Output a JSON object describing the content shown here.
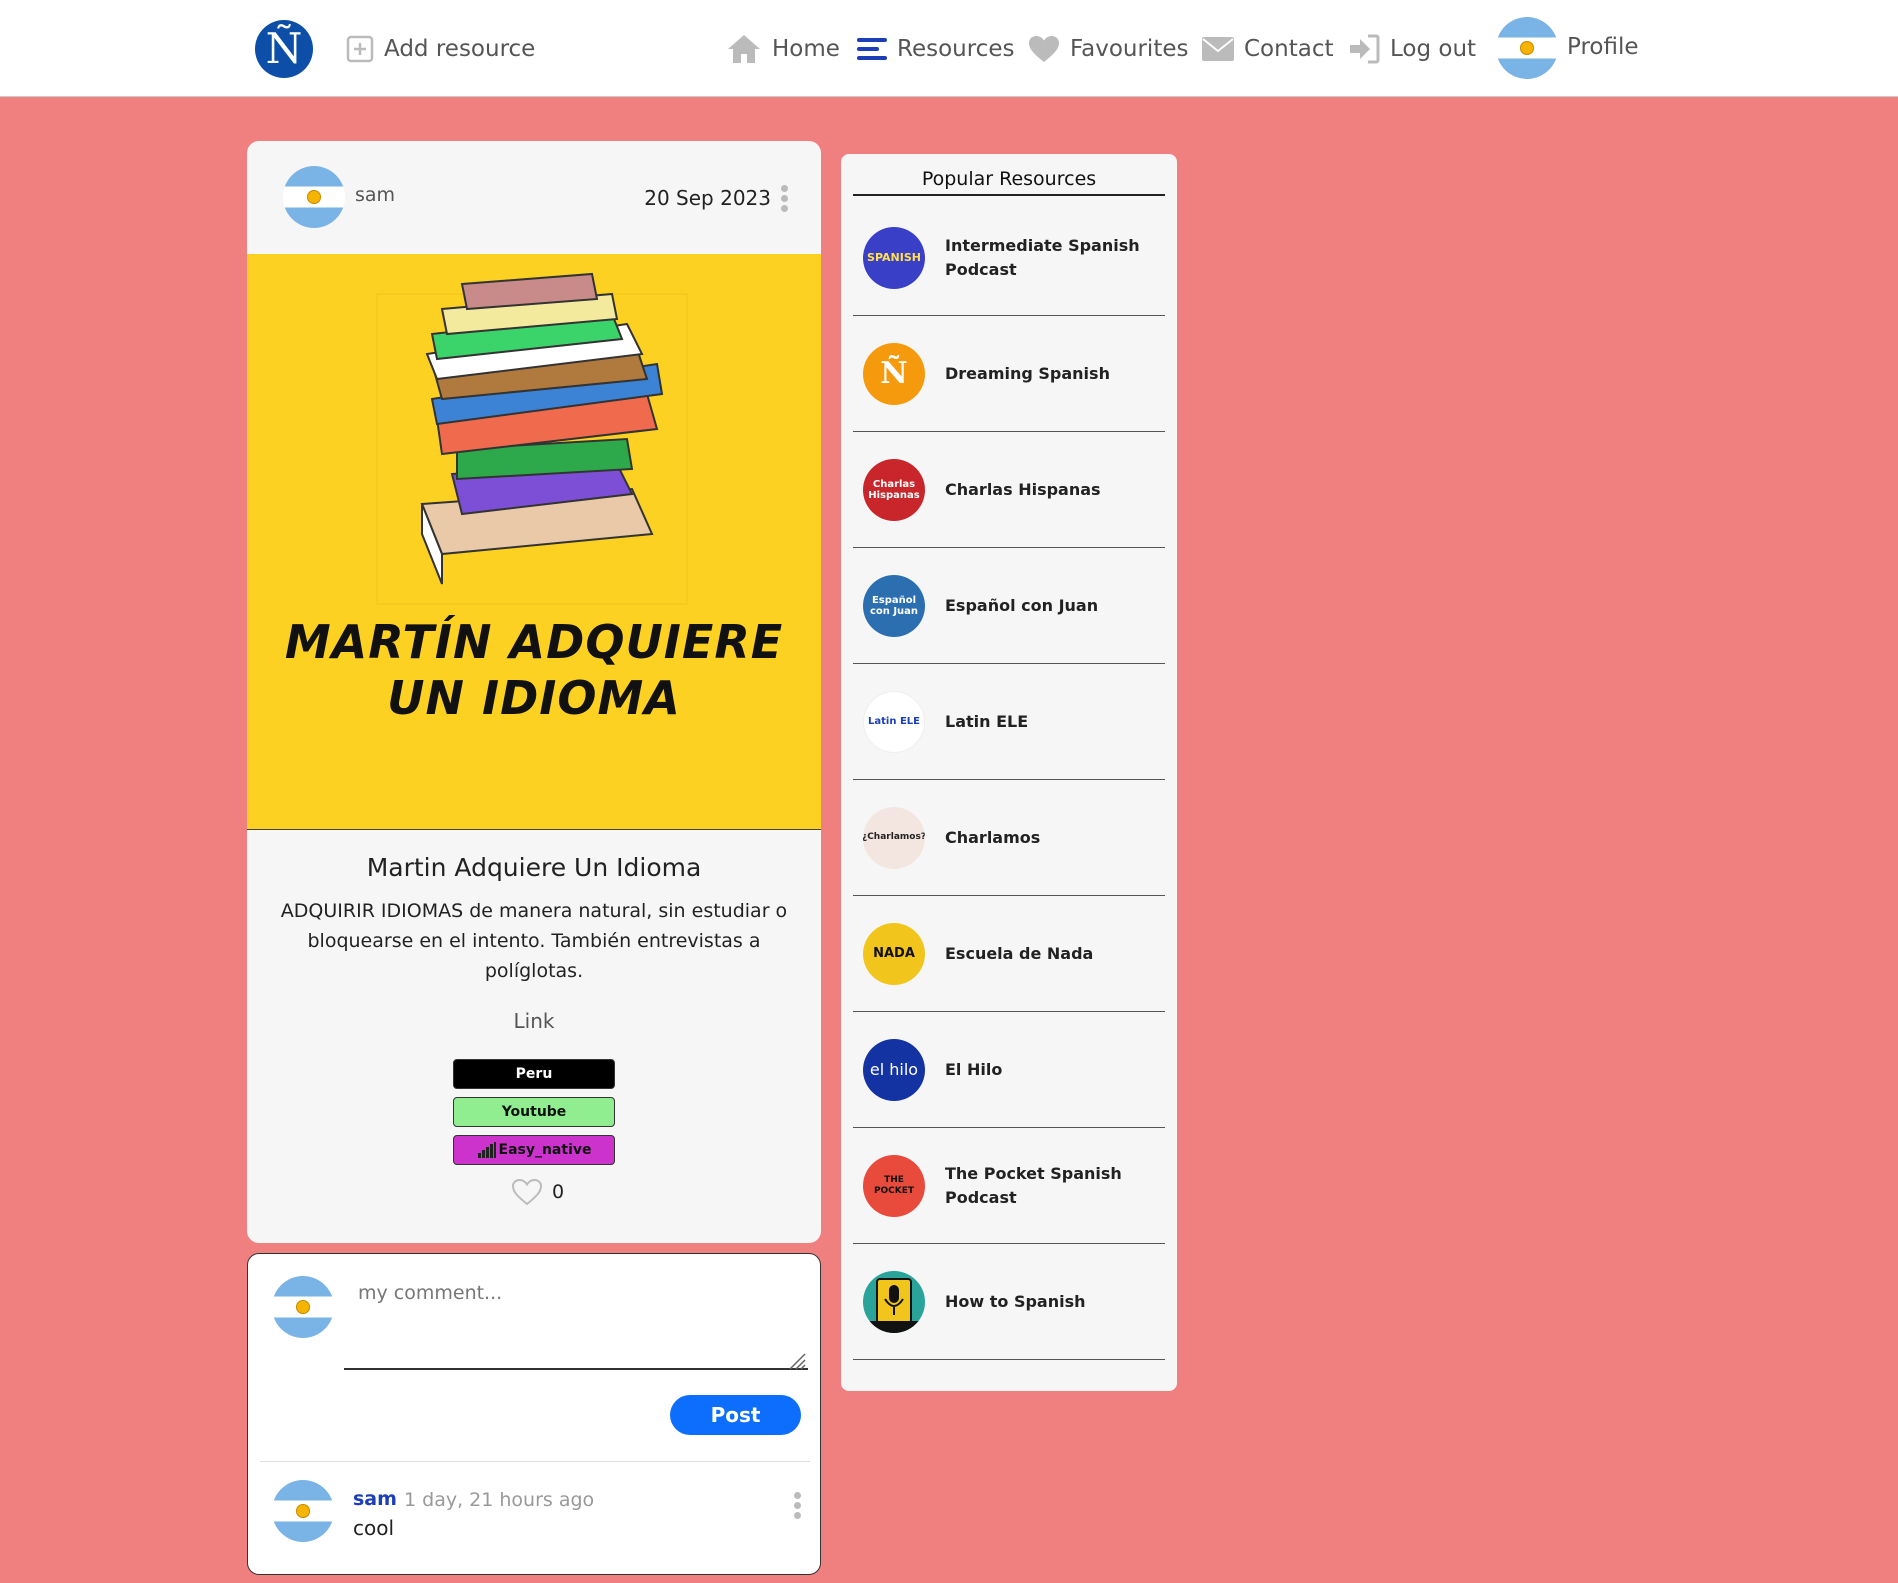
{
  "navbar": {
    "brand": "Ñ",
    "add_resource": "Add resource",
    "home": "Home",
    "resources": "Resources",
    "favourites": "Favourites",
    "contact": "Contact",
    "logout": "Log out",
    "profile": "Profile"
  },
  "post": {
    "username": "sam",
    "date": "20 Sep 2023",
    "cover_line1": "MARTÍN ADQUIERE",
    "cover_line2": "UN IDIOMA",
    "title": "Martin Adquiere Un Idioma",
    "description": "ADQUIRIR IDIOMAS de manera natural, sin estudiar o bloquearse en el intento. También entrevistas a políglotas.",
    "link_label": "Link",
    "tags": [
      {
        "label": "Peru",
        "color": "#000000",
        "text_color": "#ffffff"
      },
      {
        "label": "Youtube",
        "color": "#90ee90",
        "text_color": "#111111"
      },
      {
        "label": "Easy_native",
        "color": "#cc33cc",
        "text_color": "#111111"
      }
    ],
    "likes": "0"
  },
  "comment_form": {
    "placeholder": "my comment...",
    "post_button": "Post"
  },
  "comments": [
    {
      "user": "sam",
      "time": "1 day, 21 hours ago",
      "text": "cool"
    }
  ],
  "sidebar": {
    "title": "Popular Resources",
    "items": [
      {
        "name": "Intermediate Spanish Podcast",
        "thumb_text": "SPANISH",
        "thumb_color": "#3a3fc8"
      },
      {
        "name": "Dreaming Spanish",
        "thumb_text": "Ñ",
        "thumb_color": "#f59a0c"
      },
      {
        "name": "Charlas Hispanas",
        "thumb_text": "Charlas Hispanas",
        "thumb_color": "#c8262b"
      },
      {
        "name": "Español con Juan",
        "thumb_text": "Español con Juan",
        "thumb_color": "#2c6fb0"
      },
      {
        "name": "Latin ELE",
        "thumb_text": "Latin ELE",
        "thumb_color": "#ffffff"
      },
      {
        "name": "Charlamos",
        "thumb_text": "¿Charlamos?",
        "thumb_color": "#f3e6e0"
      },
      {
        "name": "Escuela de Nada",
        "thumb_text": "NADA",
        "thumb_color": "#f2c51c"
      },
      {
        "name": "El Hilo",
        "thumb_text": "el hilo",
        "thumb_color": "#1433a3"
      },
      {
        "name": "The Pocket Spanish Podcast",
        "thumb_text": "THE POCKET",
        "thumb_color": "#e84a3c"
      },
      {
        "name": "How to Spanish",
        "thumb_text": "",
        "thumb_color": "#2aa39a"
      }
    ]
  }
}
